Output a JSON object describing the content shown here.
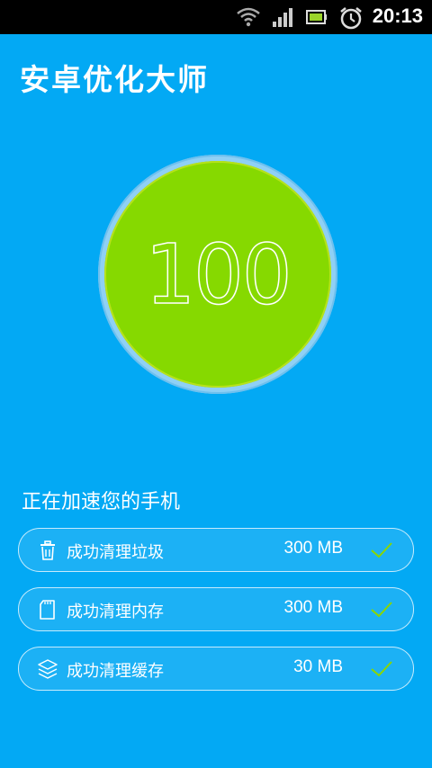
{
  "status_bar": {
    "time": "20:13",
    "icons": [
      "wifi-icon",
      "signal-icon",
      "battery-icon",
      "alarm-clock-icon"
    ]
  },
  "app": {
    "title": "安卓优化大师"
  },
  "score": {
    "value": "100",
    "ring_color": "#8fd0f5",
    "fill_color": "#86d900"
  },
  "status_text": "正在加速您的手机",
  "results": [
    {
      "icon": "trash-icon",
      "label": "成功清理垃圾",
      "size": "300 MB",
      "done": true
    },
    {
      "icon": "memory-card-icon",
      "label": "成功清理内存",
      "size": "300 MB",
      "done": true
    },
    {
      "icon": "layers-icon",
      "label": "成功清理缓存",
      "size": "30 MB",
      "done": true
    }
  ],
  "colors": {
    "background": "#03a9f4",
    "check": "#8ad600"
  }
}
